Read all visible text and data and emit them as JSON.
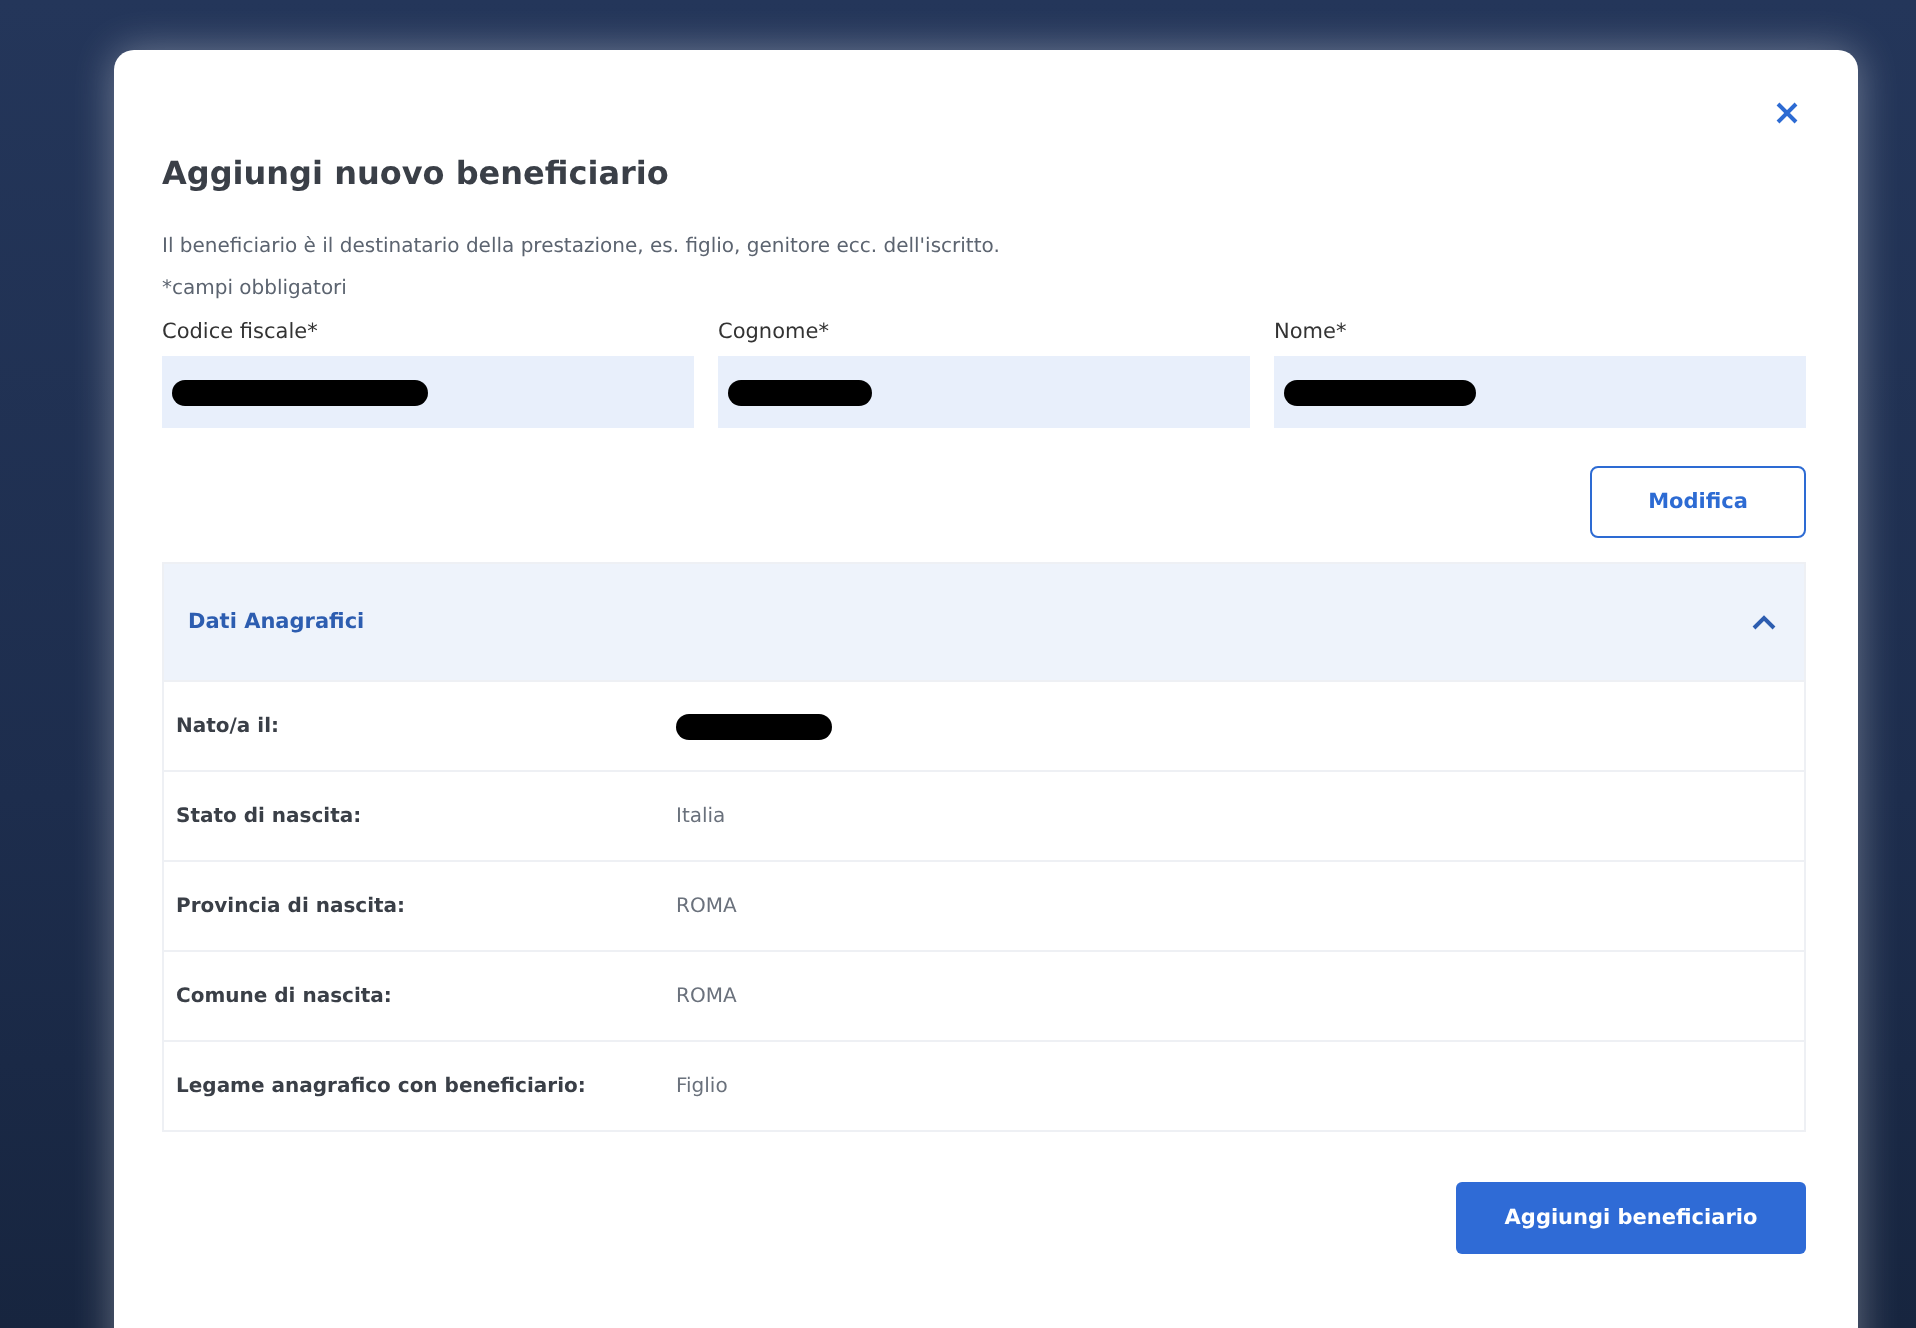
{
  "dialog": {
    "title": "Aggiungi nuovo beneficiario",
    "description": "Il beneficiario è il destinatario della prestazione, es. figlio, genitore ecc. dell'iscritto.",
    "required_note": "*campi obbligatori",
    "fields": [
      {
        "label": "Codice fiscale*",
        "redacted": true
      },
      {
        "label": "Cognome*",
        "redacted": true
      },
      {
        "label": "Nome*",
        "redacted": true
      }
    ],
    "edit_button": "Modifica",
    "section": {
      "title": "Dati Anagrafici",
      "expanded": true,
      "rows": [
        {
          "label": "Nato/a il:",
          "redacted": true
        },
        {
          "label": "Stato di nascita:",
          "value": "Italia"
        },
        {
          "label": "Provincia di nascita:",
          "value": "ROMA"
        },
        {
          "label": "Comune di nascita:",
          "value": "ROMA"
        },
        {
          "label": "Legame anagrafico con beneficiario:",
          "value": "Figlio"
        }
      ]
    },
    "submit_button": "Aggiungi beneficiario"
  }
}
